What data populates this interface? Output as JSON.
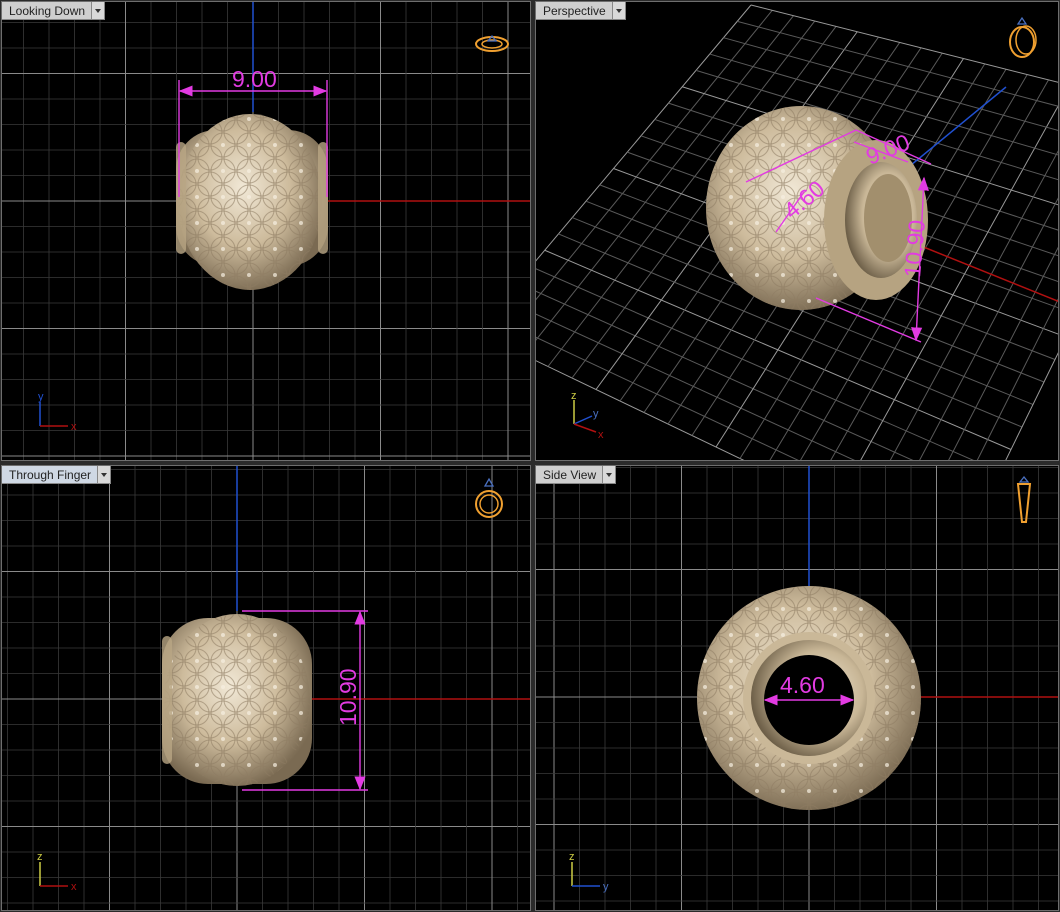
{
  "viewports": {
    "top": {
      "label": "Looking Down",
      "dimension": "9.00",
      "axis_h": "x",
      "axis_v": "y",
      "active": false
    },
    "perspective": {
      "label": "Perspective",
      "dimension_height": "10.90",
      "dimension_top": "9.00",
      "dimension_hole": "4.60",
      "axis_h": "x",
      "axis_v": "y",
      "axis_z": "z",
      "active": false
    },
    "front": {
      "label": "Through Finger",
      "dimension": "10.90",
      "axis_h": "x",
      "axis_v": "z",
      "active": true
    },
    "side": {
      "label": "Side View",
      "dimension": "4.60",
      "axis_h": "y",
      "axis_v": "z",
      "active": false
    }
  },
  "colors": {
    "grid_minor": "#3a3a3a",
    "grid_major": "#8a8a8a",
    "axis_x": "#b01010",
    "axis_y": "#2050d0",
    "dimension": "#e23be2",
    "model": "#d8c9b0",
    "ring_icon": "#f0a030"
  },
  "icons": {
    "top": "ring-top-icon",
    "perspective": "ring-perspective-icon",
    "front": "ring-front-icon",
    "side": "ring-side-icon"
  }
}
